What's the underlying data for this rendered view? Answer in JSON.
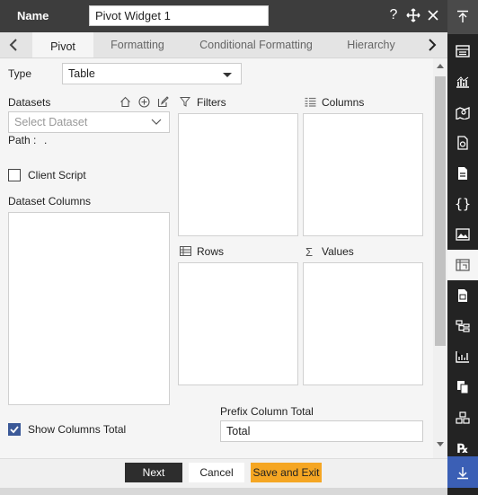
{
  "header": {
    "name_label": "Name",
    "name_value": "Pivot Widget 1"
  },
  "tabs": [
    {
      "label": "Pivot",
      "active": true
    },
    {
      "label": "Formatting",
      "active": false
    },
    {
      "label": "Conditional Formatting",
      "active": false
    },
    {
      "label": "Hierarchy",
      "active": false
    }
  ],
  "form": {
    "type_label": "Type",
    "type_value": "Table",
    "datasets_label": "Datasets",
    "dataset_placeholder": "Select Dataset",
    "path_label": "Path :",
    "path_value": ".",
    "client_script_label": "Client Script",
    "dataset_columns_label": "Dataset Columns",
    "show_columns_total_label": "Show Columns Total",
    "show_columns_total_checked": true,
    "client_script_checked": false
  },
  "zones": {
    "filters_label": "Filters",
    "columns_label": "Columns",
    "rows_label": "Rows",
    "values_label": "Values"
  },
  "prefix": {
    "label": "Prefix Column Total",
    "value": "Total"
  },
  "footer": {
    "next_label": "Next",
    "cancel_label": "Cancel",
    "save_label": "Save and Exit"
  },
  "colors": {
    "accent": "#f5a623",
    "checkbox": "#3b5998",
    "dark": "#2d2d2d",
    "sidebar": "#232323",
    "sidebar_bottom": "#3b5fb5"
  },
  "right_sidebar_icons": [
    "scroll-top-icon",
    "widget-list-icon",
    "chart-icon",
    "map-icon",
    "report-icon",
    "document-icon",
    "code-icon",
    "image-icon",
    "pivot-icon",
    "sheet-icon",
    "hierarchy-icon",
    "analytics-icon",
    "copy-icon",
    "cluster-icon",
    "rx-icon",
    "scroll-bottom-icon"
  ]
}
